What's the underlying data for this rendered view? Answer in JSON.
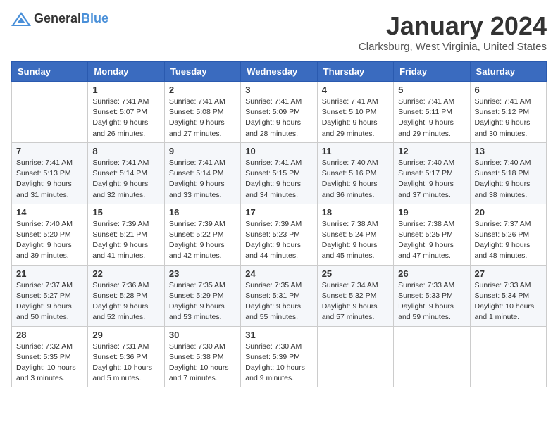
{
  "header": {
    "logo_general": "General",
    "logo_blue": "Blue",
    "month": "January 2024",
    "location": "Clarksburg, West Virginia, United States"
  },
  "weekdays": [
    "Sunday",
    "Monday",
    "Tuesday",
    "Wednesday",
    "Thursday",
    "Friday",
    "Saturday"
  ],
  "weeks": [
    [
      {
        "day": "",
        "sunrise": "",
        "sunset": "",
        "daylight": ""
      },
      {
        "day": "1",
        "sunrise": "Sunrise: 7:41 AM",
        "sunset": "Sunset: 5:07 PM",
        "daylight": "Daylight: 9 hours and 26 minutes."
      },
      {
        "day": "2",
        "sunrise": "Sunrise: 7:41 AM",
        "sunset": "Sunset: 5:08 PM",
        "daylight": "Daylight: 9 hours and 27 minutes."
      },
      {
        "day": "3",
        "sunrise": "Sunrise: 7:41 AM",
        "sunset": "Sunset: 5:09 PM",
        "daylight": "Daylight: 9 hours and 28 minutes."
      },
      {
        "day": "4",
        "sunrise": "Sunrise: 7:41 AM",
        "sunset": "Sunset: 5:10 PM",
        "daylight": "Daylight: 9 hours and 29 minutes."
      },
      {
        "day": "5",
        "sunrise": "Sunrise: 7:41 AM",
        "sunset": "Sunset: 5:11 PM",
        "daylight": "Daylight: 9 hours and 29 minutes."
      },
      {
        "day": "6",
        "sunrise": "Sunrise: 7:41 AM",
        "sunset": "Sunset: 5:12 PM",
        "daylight": "Daylight: 9 hours and 30 minutes."
      }
    ],
    [
      {
        "day": "7",
        "sunrise": "Sunrise: 7:41 AM",
        "sunset": "Sunset: 5:13 PM",
        "daylight": "Daylight: 9 hours and 31 minutes."
      },
      {
        "day": "8",
        "sunrise": "Sunrise: 7:41 AM",
        "sunset": "Sunset: 5:14 PM",
        "daylight": "Daylight: 9 hours and 32 minutes."
      },
      {
        "day": "9",
        "sunrise": "Sunrise: 7:41 AM",
        "sunset": "Sunset: 5:14 PM",
        "daylight": "Daylight: 9 hours and 33 minutes."
      },
      {
        "day": "10",
        "sunrise": "Sunrise: 7:41 AM",
        "sunset": "Sunset: 5:15 PM",
        "daylight": "Daylight: 9 hours and 34 minutes."
      },
      {
        "day": "11",
        "sunrise": "Sunrise: 7:40 AM",
        "sunset": "Sunset: 5:16 PM",
        "daylight": "Daylight: 9 hours and 36 minutes."
      },
      {
        "day": "12",
        "sunrise": "Sunrise: 7:40 AM",
        "sunset": "Sunset: 5:17 PM",
        "daylight": "Daylight: 9 hours and 37 minutes."
      },
      {
        "day": "13",
        "sunrise": "Sunrise: 7:40 AM",
        "sunset": "Sunset: 5:18 PM",
        "daylight": "Daylight: 9 hours and 38 minutes."
      }
    ],
    [
      {
        "day": "14",
        "sunrise": "Sunrise: 7:40 AM",
        "sunset": "Sunset: 5:20 PM",
        "daylight": "Daylight: 9 hours and 39 minutes."
      },
      {
        "day": "15",
        "sunrise": "Sunrise: 7:39 AM",
        "sunset": "Sunset: 5:21 PM",
        "daylight": "Daylight: 9 hours and 41 minutes."
      },
      {
        "day": "16",
        "sunrise": "Sunrise: 7:39 AM",
        "sunset": "Sunset: 5:22 PM",
        "daylight": "Daylight: 9 hours and 42 minutes."
      },
      {
        "day": "17",
        "sunrise": "Sunrise: 7:39 AM",
        "sunset": "Sunset: 5:23 PM",
        "daylight": "Daylight: 9 hours and 44 minutes."
      },
      {
        "day": "18",
        "sunrise": "Sunrise: 7:38 AM",
        "sunset": "Sunset: 5:24 PM",
        "daylight": "Daylight: 9 hours and 45 minutes."
      },
      {
        "day": "19",
        "sunrise": "Sunrise: 7:38 AM",
        "sunset": "Sunset: 5:25 PM",
        "daylight": "Daylight: 9 hours and 47 minutes."
      },
      {
        "day": "20",
        "sunrise": "Sunrise: 7:37 AM",
        "sunset": "Sunset: 5:26 PM",
        "daylight": "Daylight: 9 hours and 48 minutes."
      }
    ],
    [
      {
        "day": "21",
        "sunrise": "Sunrise: 7:37 AM",
        "sunset": "Sunset: 5:27 PM",
        "daylight": "Daylight: 9 hours and 50 minutes."
      },
      {
        "day": "22",
        "sunrise": "Sunrise: 7:36 AM",
        "sunset": "Sunset: 5:28 PM",
        "daylight": "Daylight: 9 hours and 52 minutes."
      },
      {
        "day": "23",
        "sunrise": "Sunrise: 7:35 AM",
        "sunset": "Sunset: 5:29 PM",
        "daylight": "Daylight: 9 hours and 53 minutes."
      },
      {
        "day": "24",
        "sunrise": "Sunrise: 7:35 AM",
        "sunset": "Sunset: 5:31 PM",
        "daylight": "Daylight: 9 hours and 55 minutes."
      },
      {
        "day": "25",
        "sunrise": "Sunrise: 7:34 AM",
        "sunset": "Sunset: 5:32 PM",
        "daylight": "Daylight: 9 hours and 57 minutes."
      },
      {
        "day": "26",
        "sunrise": "Sunrise: 7:33 AM",
        "sunset": "Sunset: 5:33 PM",
        "daylight": "Daylight: 9 hours and 59 minutes."
      },
      {
        "day": "27",
        "sunrise": "Sunrise: 7:33 AM",
        "sunset": "Sunset: 5:34 PM",
        "daylight": "Daylight: 10 hours and 1 minute."
      }
    ],
    [
      {
        "day": "28",
        "sunrise": "Sunrise: 7:32 AM",
        "sunset": "Sunset: 5:35 PM",
        "daylight": "Daylight: 10 hours and 3 minutes."
      },
      {
        "day": "29",
        "sunrise": "Sunrise: 7:31 AM",
        "sunset": "Sunset: 5:36 PM",
        "daylight": "Daylight: 10 hours and 5 minutes."
      },
      {
        "day": "30",
        "sunrise": "Sunrise: 7:30 AM",
        "sunset": "Sunset: 5:38 PM",
        "daylight": "Daylight: 10 hours and 7 minutes."
      },
      {
        "day": "31",
        "sunrise": "Sunrise: 7:30 AM",
        "sunset": "Sunset: 5:39 PM",
        "daylight": "Daylight: 10 hours and 9 minutes."
      },
      {
        "day": "",
        "sunrise": "",
        "sunset": "",
        "daylight": ""
      },
      {
        "day": "",
        "sunrise": "",
        "sunset": "",
        "daylight": ""
      },
      {
        "day": "",
        "sunrise": "",
        "sunset": "",
        "daylight": ""
      }
    ]
  ]
}
